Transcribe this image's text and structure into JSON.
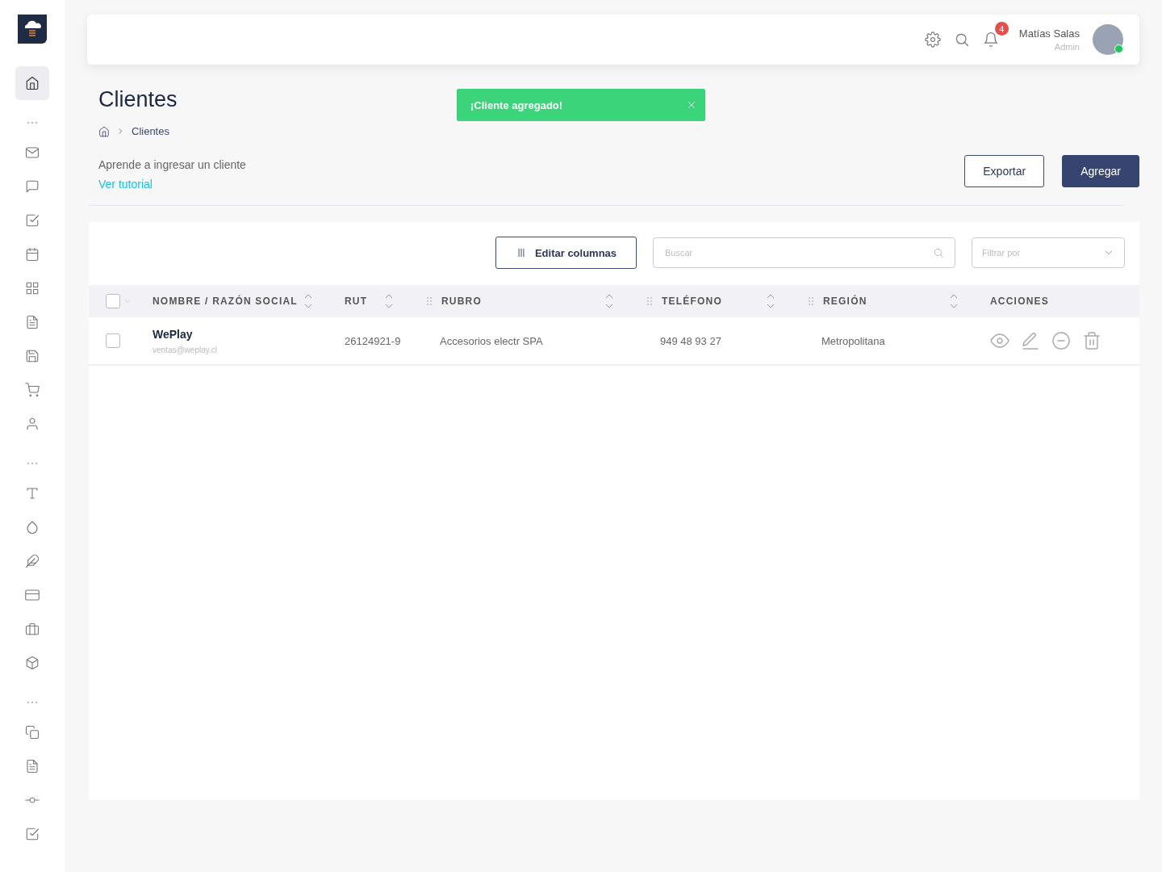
{
  "sidebar": {
    "sections": [
      [
        {
          "selected": true
        }
      ],
      [
        {
          "selected": false
        },
        {
          "selected": false
        },
        {
          "selected": false
        },
        {
          "selected": false
        },
        {
          "selected": false
        },
        {
          "selected": false
        },
        {
          "selected": false
        },
        {
          "selected": false
        },
        {
          "selected": false
        }
      ],
      [
        {
          "selected": false
        },
        {
          "selected": false
        },
        {
          "selected": false
        },
        {
          "selected": false
        },
        {
          "selected": false
        },
        {
          "selected": false
        }
      ],
      [
        {
          "selected": false
        },
        {
          "selected": false
        },
        {
          "selected": false
        },
        {
          "selected": false
        }
      ]
    ]
  },
  "topbar": {
    "notification_count": "4",
    "user": {
      "name": "Matías Salas",
      "role": "Admin",
      "online": true
    }
  },
  "page": {
    "title": "Clientes",
    "breadcrumb": [
      "Clientes"
    ],
    "hint": "Aprende a ingresar un cliente",
    "hint_link": "Ver tutorial",
    "buttons": [
      {
        "label": "Exportar",
        "kind": "outline"
      },
      {
        "label": "Agregar",
        "kind": "primary"
      }
    ]
  },
  "toast": {
    "message": "¡Cliente agregado!"
  },
  "toolbar": {
    "columns_button": "Editar columnas",
    "search": {
      "placeholder": "Buscar"
    },
    "filter": {
      "placeholder": "Filtrar por"
    }
  },
  "table": {
    "header_checkbox": {
      "checked": false
    },
    "columns": [
      {
        "label": "NOMBRE / RAZÓN SOCIAL",
        "sortable": true,
        "draggable": false
      },
      {
        "label": "RUT",
        "sortable": true,
        "draggable": false
      },
      {
        "label": "RUBRO",
        "sortable": true,
        "draggable": true
      },
      {
        "label": "TELÉFONO",
        "sortable": true,
        "draggable": true
      },
      {
        "label": "REGIÓN",
        "sortable": true,
        "draggable": true
      },
      {
        "label": "ACCIONES",
        "sortable": false,
        "draggable": false
      }
    ],
    "rows": [
      {
        "checked": false,
        "name": "WePlay",
        "email": "ventas@weplay.cl",
        "rut": "26124921-9",
        "rubro": "Accesorios electr SPA",
        "telefono": "949 48 93 27",
        "region": "Metropolitana"
      }
    ]
  }
}
